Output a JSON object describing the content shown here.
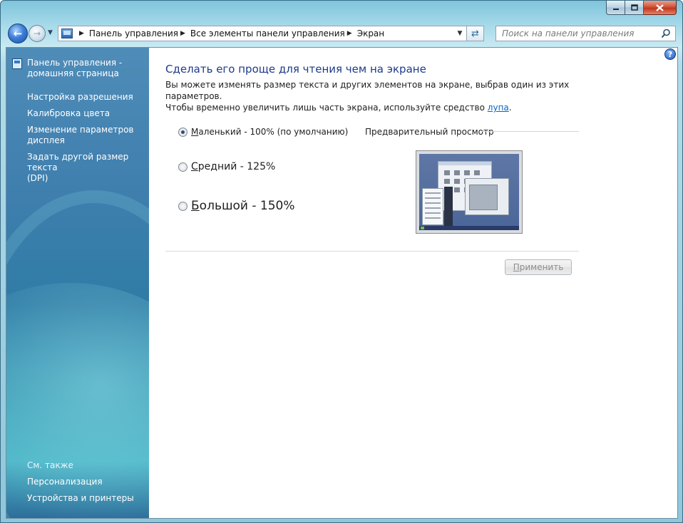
{
  "window": {
    "caption_buttons": {
      "minimize_icon": "minimize-icon",
      "maximize_icon": "maximize-icon",
      "close_icon": "close-icon"
    }
  },
  "nav": {
    "breadcrumbs": [
      "Панель управления",
      "Все элементы панели управления",
      "Экран"
    ],
    "search_placeholder": "Поиск на панели управления"
  },
  "sidebar": {
    "home_line1": "Панель управления -",
    "home_line2": "домашняя страница",
    "items": [
      "Настройка разрешения",
      "Калибровка цвета",
      "Изменение параметров",
      "дисплея",
      "Задать другой размер текста",
      "(DPI)"
    ],
    "see_also": "См. также",
    "see_also_items": [
      "Персонализация",
      "Устройства и принтеры"
    ]
  },
  "main": {
    "title": "Сделать его проще для чтения чем на экране",
    "description_line1": "Вы можете изменять размер текста и других элементов на экране, выбрав один из этих параметров.",
    "description_line2": "Чтобы временно увеличить лишь часть экрана, используйте средство ",
    "description_link": "лупа",
    "description_end": ".",
    "options": [
      {
        "accel": "М",
        "rest": "аленький - 100% (по умолчанию)",
        "checked": true
      },
      {
        "accel": "С",
        "rest": "редний - 125%",
        "checked": false
      },
      {
        "accel": "Б",
        "rest": "ольшой - 150%",
        "checked": false
      }
    ],
    "preview_label": "Предварительный просмотр",
    "apply_accel": "П",
    "apply_rest": "рименить"
  }
}
